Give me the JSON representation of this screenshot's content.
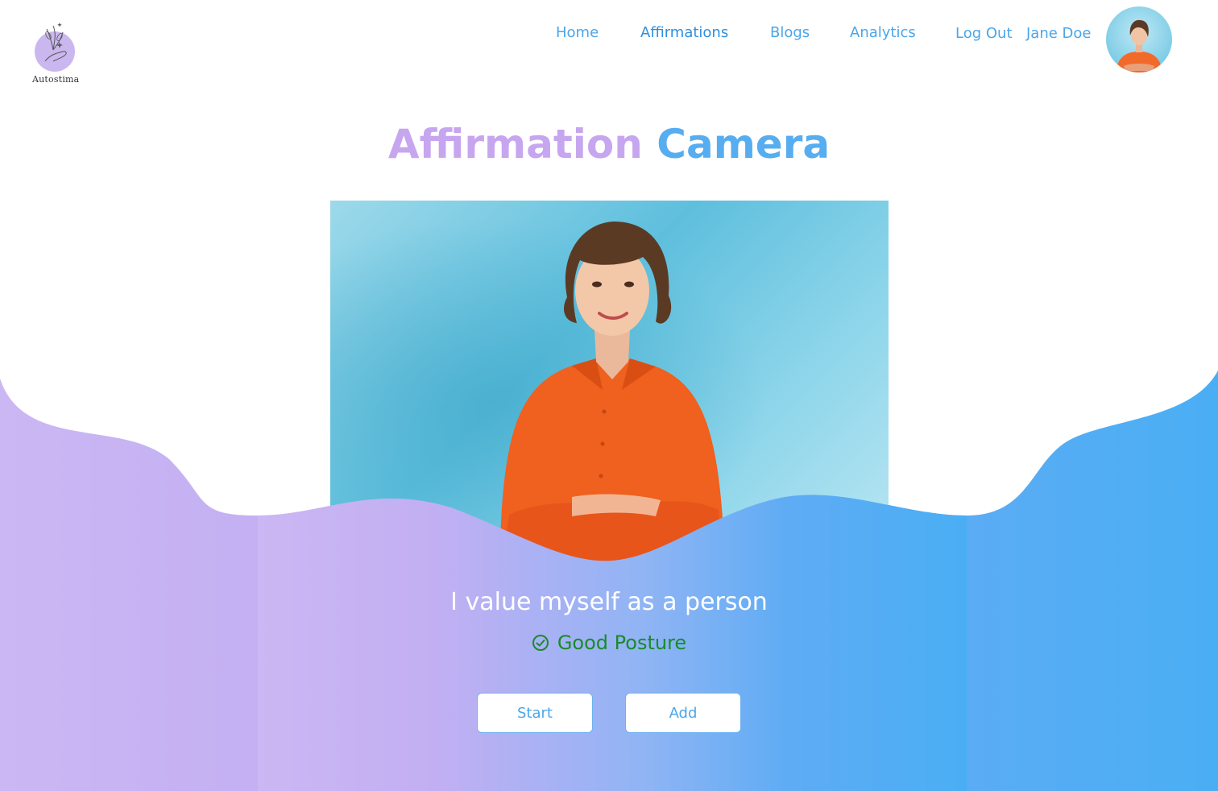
{
  "brand": {
    "name": "Autostima"
  },
  "nav": {
    "items": [
      {
        "label": "Home"
      },
      {
        "label": "Affirmations"
      },
      {
        "label": "Blogs"
      },
      {
        "label": "Analytics"
      },
      {
        "label": "Log Out"
      }
    ]
  },
  "user": {
    "name": "Jane Doe"
  },
  "main": {
    "title_part1": "Affirmation",
    "title_part2": "Camera",
    "affirmation": "I value myself as a person",
    "status": {
      "label": "Good Posture",
      "icon": "check-circle-icon",
      "color": "#1a8a2a"
    },
    "buttons": {
      "start_label": "Start",
      "add_label": "Add"
    }
  },
  "colors": {
    "accent_blue": "#4aa6ea",
    "accent_purple": "#c7a6f0",
    "gradient_left": "#cbb7f3",
    "gradient_right": "#4aaef4"
  }
}
